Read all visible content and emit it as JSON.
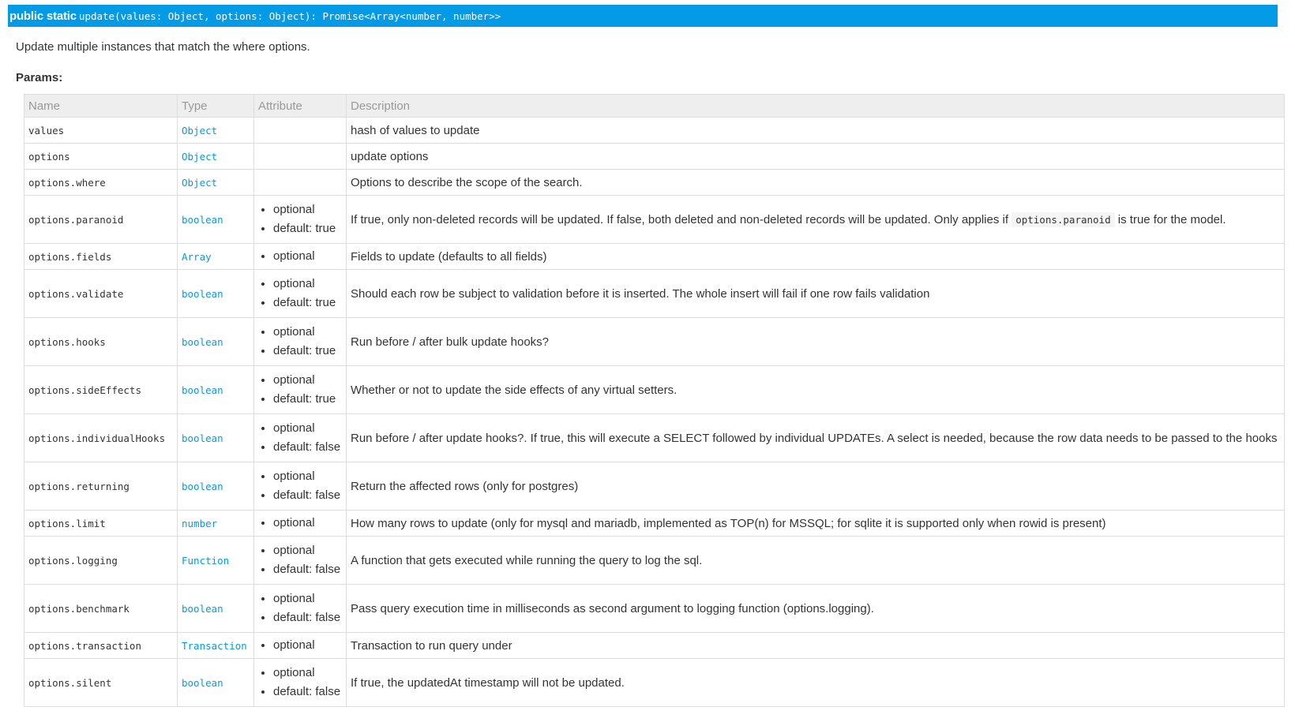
{
  "signature": {
    "modifiers": "public static",
    "code": "update(values: Object, options: Object): Promise<Array<number, number>>"
  },
  "summary": "Update multiple instances that match the where options.",
  "params_heading": "Params:",
  "columns": {
    "name": "Name",
    "type": "Type",
    "attribute": "Attribute",
    "description": "Description"
  },
  "rows": [
    {
      "name": "values",
      "type": "Object",
      "attrs": [],
      "description": "hash of values to update"
    },
    {
      "name": "options",
      "type": "Object",
      "attrs": [],
      "description": "update options"
    },
    {
      "name": "options.where",
      "type": "Object",
      "attrs": [],
      "description": "Options to describe the scope of the search."
    },
    {
      "name": "options.paranoid",
      "type": "boolean",
      "attrs": [
        "optional",
        "default: true"
      ],
      "description": "If true, only non-deleted records will be updated. If false, both deleted and non-deleted records will be updated. Only applies if ",
      "description_code": "options.paranoid",
      "description_after": " is true for the model."
    },
    {
      "name": "options.fields",
      "type": "Array",
      "attrs": [
        "optional"
      ],
      "description": "Fields to update (defaults to all fields)"
    },
    {
      "name": "options.validate",
      "type": "boolean",
      "attrs": [
        "optional",
        "default: true"
      ],
      "description": "Should each row be subject to validation before it is inserted. The whole insert will fail if one row fails validation"
    },
    {
      "name": "options.hooks",
      "type": "boolean",
      "attrs": [
        "optional",
        "default: true"
      ],
      "description": "Run before / after bulk update hooks?"
    },
    {
      "name": "options.sideEffects",
      "type": "boolean",
      "attrs": [
        "optional",
        "default: true"
      ],
      "description": "Whether or not to update the side effects of any virtual setters."
    },
    {
      "name": "options.individualHooks",
      "type": "boolean",
      "attrs": [
        "optional",
        "default: false"
      ],
      "description": "Run before / after update hooks?. If true, this will execute a SELECT followed by individual UPDATEs. A select is needed, because the row data needs to be passed to the hooks"
    },
    {
      "name": "options.returning",
      "type": "boolean",
      "attrs": [
        "optional",
        "default: false"
      ],
      "description": "Return the affected rows (only for postgres)"
    },
    {
      "name": "options.limit",
      "type": "number",
      "attrs": [
        "optional"
      ],
      "description": "How many rows to update (only for mysql and mariadb, implemented as TOP(n) for MSSQL; for sqlite it is supported only when rowid is present)"
    },
    {
      "name": "options.logging",
      "type": "Function",
      "attrs": [
        "optional",
        "default: false"
      ],
      "description": "A function that gets executed while running the query to log the sql."
    },
    {
      "name": "options.benchmark",
      "type": "boolean",
      "attrs": [
        "optional",
        "default: false"
      ],
      "description": "Pass query execution time in milliseconds as second argument to logging function (options.logging)."
    },
    {
      "name": "options.transaction",
      "type": "Transaction",
      "attrs": [
        "optional"
      ],
      "description": "Transaction to run query under"
    },
    {
      "name": "options.silent",
      "type": "boolean",
      "attrs": [
        "optional",
        "default: false"
      ],
      "description": "If true, the updatedAt timestamp will not be updated."
    }
  ]
}
